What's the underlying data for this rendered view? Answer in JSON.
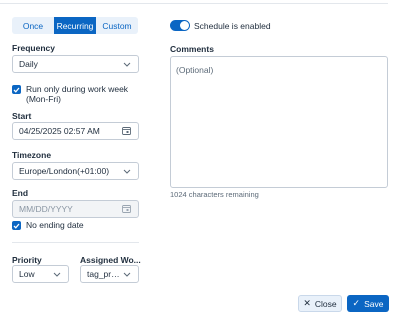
{
  "schedule_type": {
    "options": [
      "Once",
      "Recurring",
      "Custom"
    ],
    "selected": "Recurring"
  },
  "frequency": {
    "label": "Frequency",
    "value": "Daily"
  },
  "workweek": {
    "label_line1": "Run only during work week",
    "label_line2": "(Mon-Fri)",
    "checked": true
  },
  "start": {
    "label": "Start",
    "value": "04/25/2025 02:57 AM"
  },
  "timezone": {
    "label": "Timezone",
    "value": "Europe/London(+01:00)"
  },
  "end": {
    "label": "End",
    "placeholder": "MM/DD/YYYY"
  },
  "no_end": {
    "label": "No ending date",
    "checked": true
  },
  "priority": {
    "label": "Priority",
    "value": "Low"
  },
  "assigned": {
    "label": "Assigned Wo...",
    "value": "tag_prd..."
  },
  "schedule_toggle": {
    "label": "Schedule is enabled",
    "on": true
  },
  "comments": {
    "label": "Comments",
    "placeholder": "(Optional)",
    "remaining": "1024 characters remaining"
  },
  "buttons": {
    "close": "Close",
    "save": "Save"
  },
  "colors": {
    "accent": "#0b66c3"
  }
}
